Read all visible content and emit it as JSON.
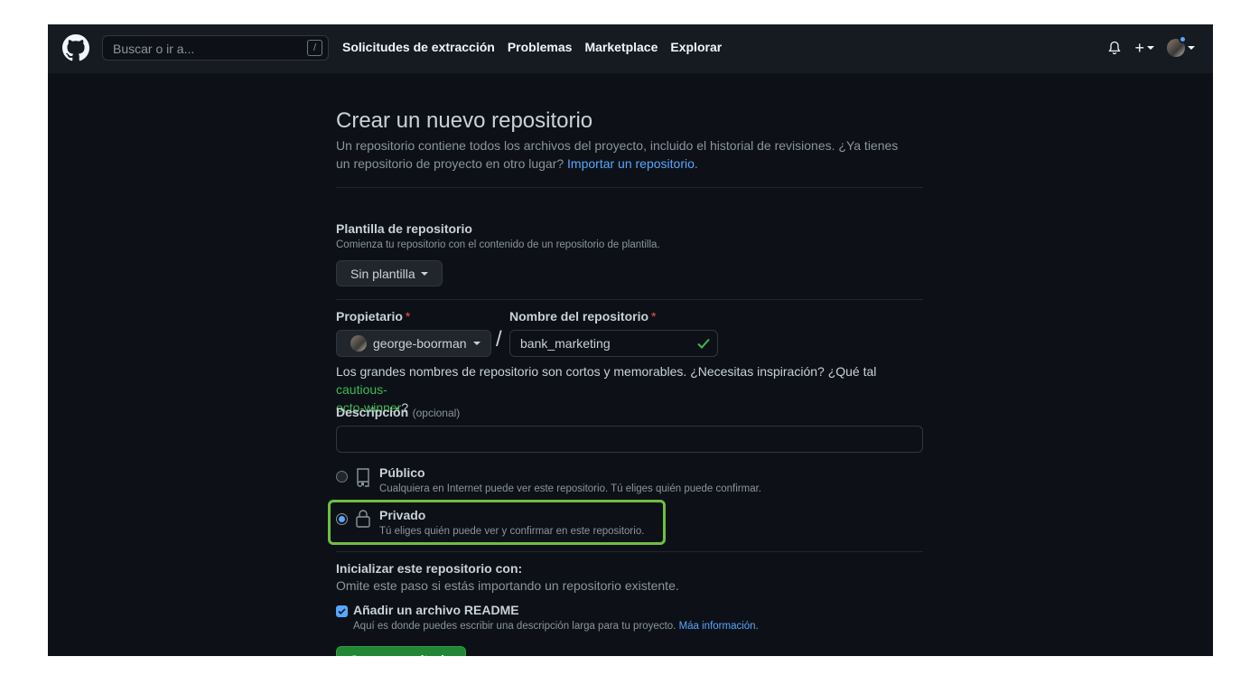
{
  "header": {
    "search_placeholder": "Buscar o ir a...",
    "search_shortcut": "/",
    "nav": [
      "Solicitudes de extracción",
      "Problemas",
      "Marketplace",
      "Explorar"
    ]
  },
  "page": {
    "title": "Crear un nuevo repositorio",
    "lead_text": "Un repositorio contiene todos los archivos del proyecto, incluido el historial de revisiones. ¿Ya tienes un repositorio de proyecto en otro lugar? ",
    "import_link": "Importar un repositorio."
  },
  "template": {
    "label": "Plantilla de repositorio",
    "note": "Comienza tu repositorio con el contenido de un repositorio de plantilla.",
    "button": "Sin plantilla"
  },
  "owner": {
    "label": "Propietario",
    "required_mark": "*",
    "value": "george-boorman"
  },
  "repo_name": {
    "label": "Nombre del repositorio",
    "required_mark": "*",
    "value": "bank_marketing",
    "separator": "/"
  },
  "suggestion": {
    "text": "Los grandes nombres de repositorio son cortos y memorables. ¿Necesitas inspiración? ¿Qué tal ",
    "name_part1": "cautious-",
    "name_part2": "octo-winner",
    "end": "?"
  },
  "description": {
    "label": "Descripción",
    "optional": "(opcional)",
    "value": ""
  },
  "visibility": {
    "public_label": "Público",
    "public_note": "Cualquiera en Internet puede ver este repositorio. Tú eliges quién puede confirmar.",
    "private_label": "Privado",
    "private_note": "Tú eliges quién puede ver y confirmar en este repositorio.",
    "selected": "Privado"
  },
  "init": {
    "label": "Inicializar este repositorio con:",
    "note": "Omite este paso si estás importando un repositorio existente.",
    "readme_label": "Añadir un archivo README",
    "readme_note": "Aquí es donde puedes escribir una descripción larga para tu proyecto. ",
    "readme_link": "Máa información."
  },
  "submit": {
    "label": "Crear repositorio"
  },
  "colors": {
    "background": "#0d1117",
    "header": "#161b22",
    "link": "#58a6ff",
    "primary_button": "#238636",
    "highlight": "#6fbf3f",
    "suggestion": "#3fb950"
  }
}
